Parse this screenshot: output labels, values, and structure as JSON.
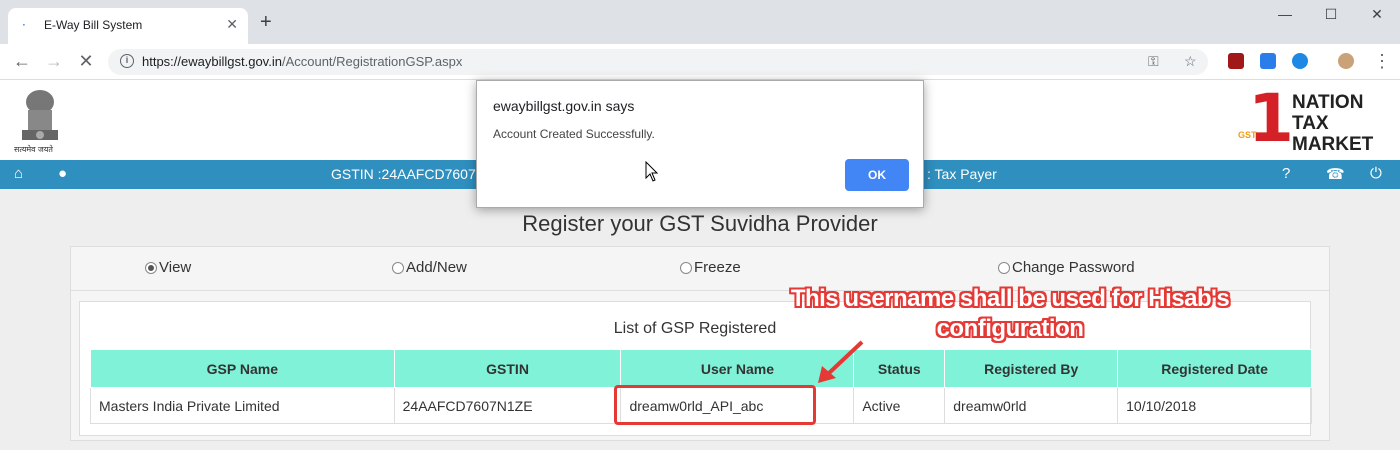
{
  "browser": {
    "tab_title": "E-Way Bill System",
    "url_host": "https://ewaybillgst.gov.in",
    "url_path": "/Account/RegistrationGSP.aspx"
  },
  "site": {
    "emblem_caption": "सत्यमेव जयते",
    "brand_lines": [
      "NATION",
      "TAX",
      "MARKET"
    ],
    "brand_badge": "GST",
    "gstin_label": "GSTIN :24AAFCD7607",
    "user_type": ": Tax Payer"
  },
  "page": {
    "heading": "Register your GST Suvidha Provider",
    "radios": [
      {
        "label": "View",
        "checked": true
      },
      {
        "label": "Add/New",
        "checked": false
      },
      {
        "label": "Freeze",
        "checked": false
      },
      {
        "label": "Change Password",
        "checked": false
      }
    ],
    "list_title": "List of GSP Registered",
    "columns": [
      "GSP Name",
      "GSTIN",
      "User Name",
      "Status",
      "Registered By",
      "Registered Date"
    ],
    "rows": [
      [
        "Masters India Private Limited",
        "24AAFCD7607N1ZE",
        "dreamw0rld_API_abc",
        "Active",
        "dreamw0rld",
        "10/10/2018"
      ]
    ]
  },
  "annotation": {
    "text": "This username shall be used for Hisab's configuration",
    "color": "#e53935"
  },
  "dialog": {
    "title": "ewaybillgst.gov.in says",
    "message": "Account Created Successfully.",
    "ok_label": "OK"
  },
  "colors": {
    "nav_bar": "#2f8fbf",
    "table_header": "#7ff2d8",
    "ok_button": "#4285f4"
  }
}
